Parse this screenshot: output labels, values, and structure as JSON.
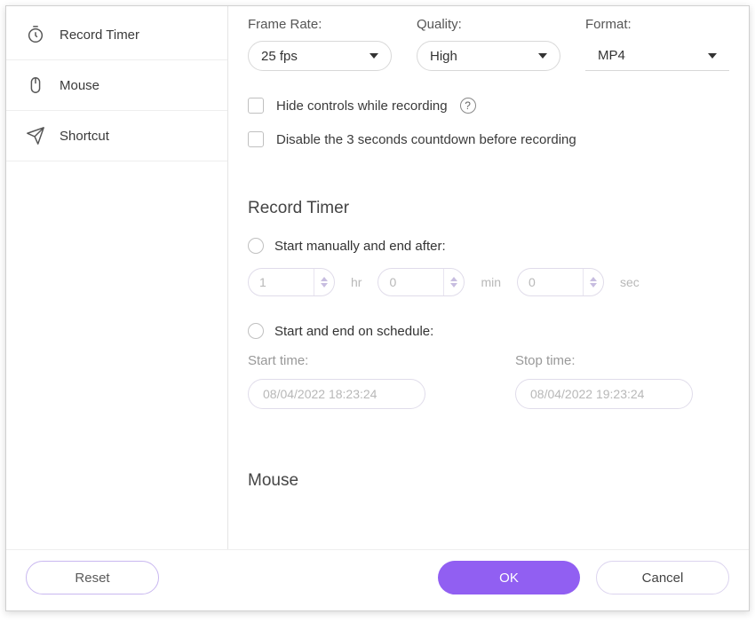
{
  "sidebar": {
    "items": [
      {
        "label": "Record Timer",
        "icon": "timer-icon"
      },
      {
        "label": "Mouse",
        "icon": "mouse-icon"
      },
      {
        "label": "Shortcut",
        "icon": "shortcut-icon"
      }
    ]
  },
  "top_fields": {
    "frame_rate": {
      "label": "Frame Rate:",
      "value": "25 fps"
    },
    "quality": {
      "label": "Quality:",
      "value": "High"
    },
    "format": {
      "label": "Format:",
      "value": "MP4"
    }
  },
  "checkboxes": {
    "hide_controls": "Hide controls while recording",
    "disable_countdown": "Disable the 3 seconds countdown before recording"
  },
  "record_timer": {
    "title": "Record Timer",
    "manual_label": "Start manually and end after:",
    "schedule_label": "Start and end on schedule:",
    "hr_value": "1",
    "hr_unit": "hr",
    "min_value": "0",
    "min_unit": "min",
    "sec_value": "0",
    "sec_unit": "sec",
    "start_time_label": "Start time:",
    "start_time_value": "08/04/2022 18:23:24",
    "stop_time_label": "Stop time:",
    "stop_time_value": "08/04/2022 19:23:24"
  },
  "mouse_section": {
    "title": "Mouse"
  },
  "footer": {
    "reset": "Reset",
    "ok": "OK",
    "cancel": "Cancel"
  }
}
